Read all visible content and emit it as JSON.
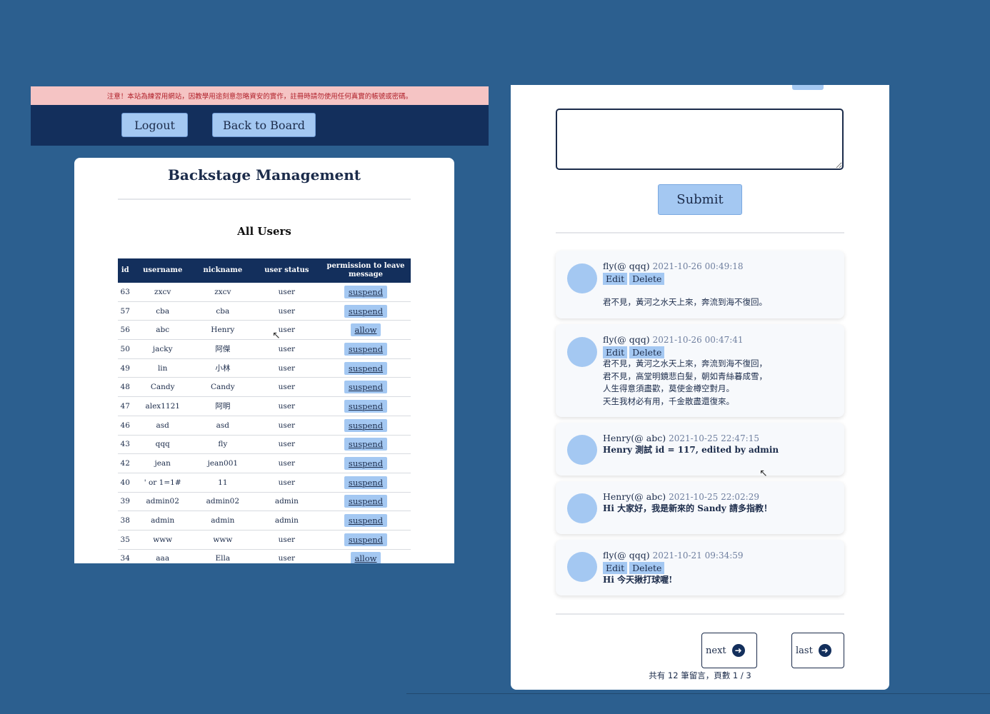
{
  "left": {
    "warning": "注意！本站為練習用網站，因教學用途刻意忽略資安的實作，註冊時請勿使用任何真實的帳號或密碼。",
    "nav": {
      "logout_label": "Logout",
      "back_label": "Back to Board"
    },
    "title": "Backstage Management",
    "section_title": "All Users",
    "table": {
      "headers": [
        "id",
        "username",
        "nickname",
        "user status",
        "permission to leave message"
      ],
      "rows": [
        [
          "63",
          "zxcv",
          "zxcv",
          "user",
          "suspend"
        ],
        [
          "57",
          "cba",
          "cba",
          "user",
          "suspend"
        ],
        [
          "56",
          "abc",
          "Henry",
          "user",
          "allow"
        ],
        [
          "50",
          "jacky",
          "阿傑",
          "user",
          "suspend"
        ],
        [
          "49",
          "lin",
          "小林",
          "user",
          "suspend"
        ],
        [
          "48",
          "Candy",
          "Candy",
          "user",
          "suspend"
        ],
        [
          "47",
          "alex1121",
          "阿明",
          "user",
          "suspend"
        ],
        [
          "46",
          "asd",
          "asd",
          "user",
          "suspend"
        ],
        [
          "43",
          "qqq",
          "fly",
          "user",
          "suspend"
        ],
        [
          "42",
          "jean",
          "jean001",
          "user",
          "suspend"
        ],
        [
          "40",
          "' or 1=1#",
          "11",
          "user",
          "suspend"
        ],
        [
          "39",
          "admin02",
          "admin02",
          "admin",
          "suspend"
        ],
        [
          "38",
          "admin",
          "admin",
          "admin",
          "suspend"
        ],
        [
          "35",
          "www",
          "www",
          "user",
          "suspend"
        ],
        [
          "34",
          "aaa",
          "Ella",
          "user",
          "allow"
        ]
      ]
    }
  },
  "right": {
    "textarea_value": "",
    "submit_label": "Submit",
    "comments": [
      {
        "author": "fly(@ qqq)",
        "time": "2021-10-26 00:49:18",
        "edit": "Edit",
        "delete": "Delete",
        "body": "君不見，黃河之水天上來，奔流到海不復回。"
      },
      {
        "author": "fly(@ qqq)",
        "time": "2021-10-26 00:47:41",
        "edit": "Edit",
        "delete": "Delete",
        "body": "君不見，黃河之水天上來，奔流到海不復回，\n君不見，高堂明鏡悲白髮，朝如青絲暮成雪，\n人生得意須盡歡，莫使金樽空對月。\n天生我材必有用，千金散盡還復來。"
      },
      {
        "author": "Henry(@ abc)",
        "time": "2021-10-25 22:47:15",
        "body": "Henry 測試 id = 117, edited by admin"
      },
      {
        "author": "Henry(@ abc)",
        "time": "2021-10-25 22:02:29",
        "body": "Hi 大家好，我是新來的 Sandy 請多指教！"
      },
      {
        "author": "fly(@ qqq)",
        "time": "2021-10-21 09:34:59",
        "edit": "Edit",
        "delete": "Delete",
        "body": "Hi 今天揪打球喔!"
      }
    ],
    "pagination": {
      "next_label": "next",
      "last_label": "last",
      "info": "共有 12 筆留言，頁數 1 / 3"
    },
    "icons": {
      "arrow": "arrow-right-circle-icon",
      "cursor": "mouse-pointer-icon"
    }
  }
}
